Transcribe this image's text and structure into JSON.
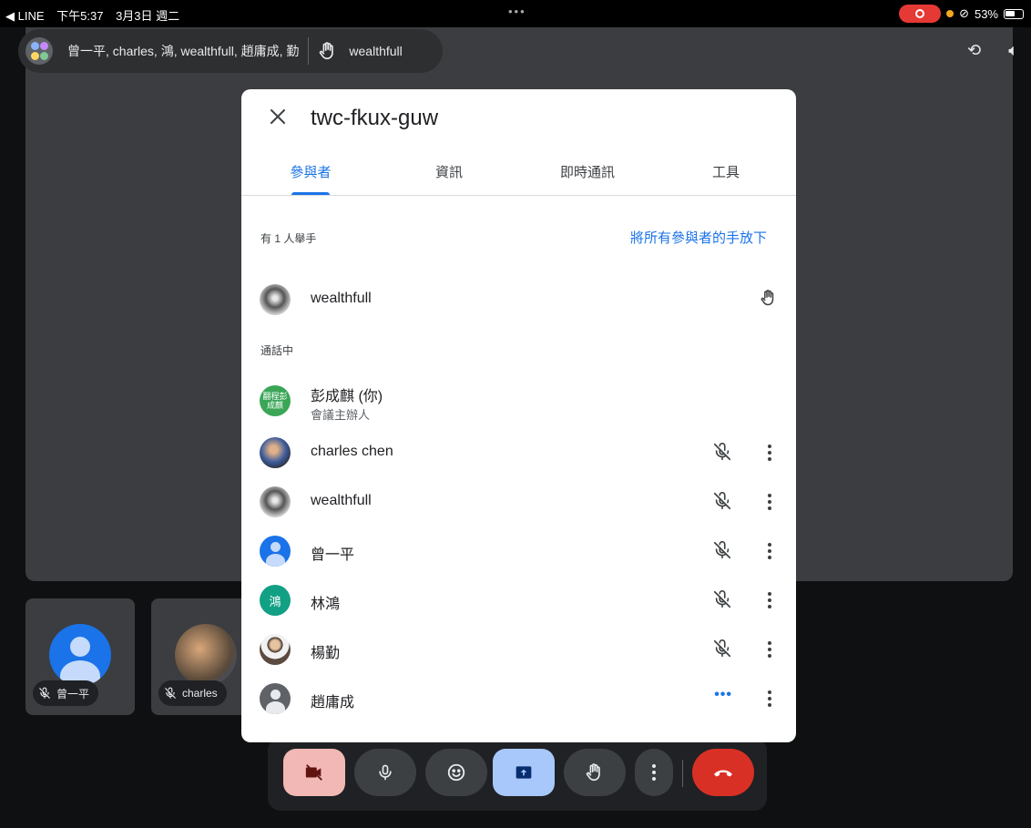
{
  "status_bar": {
    "back_app": "◀ LINE",
    "time": "下午5:37",
    "date": "3月3日 週二",
    "dots": "•••",
    "battery": "53%"
  },
  "meeting": {
    "participants_summary": "曾一平, charles, 鴻, wealthfull, 趙庸成, 勤",
    "raised_hand_name": "wealthfull",
    "tiles": [
      {
        "label": "曾一平"
      },
      {
        "label": "charles"
      }
    ]
  },
  "modal": {
    "title": "twc-fkux-guw",
    "tabs": [
      "參與者",
      "資訊",
      "即時通訊",
      "工具"
    ],
    "active_tab": 0,
    "raised_section_label": "有 1 人舉手",
    "lower_all_hands": "將所有參與者的手放下",
    "raised": [
      {
        "name": "wealthfull"
      }
    ],
    "in_call_label": "通話中",
    "participants": [
      {
        "name": "彭成麒 (你)",
        "subtitle": "會議主辦人",
        "avatar_text": "翻程彭成麒"
      },
      {
        "name": "charles chen"
      },
      {
        "name": "wealthfull"
      },
      {
        "name": "曾一平"
      },
      {
        "name": "林鴻",
        "avatar_text": "鴻"
      },
      {
        "name": "楊勤"
      },
      {
        "name": "趙庸成"
      }
    ]
  },
  "colors": {
    "accent": "#1a73e8",
    "end_call": "#d93025",
    "camera_off": "#f2b8b5",
    "present": "#a8c7fa"
  }
}
